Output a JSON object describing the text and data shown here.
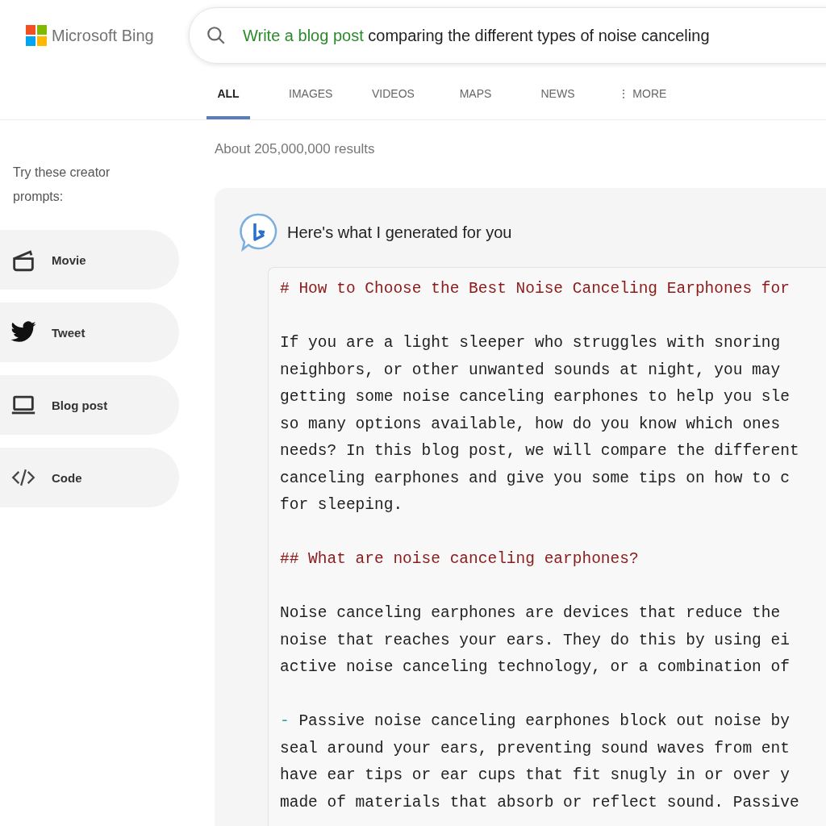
{
  "logo": {
    "text": "Microsoft Bing"
  },
  "search": {
    "highlight": "Write a blog post",
    "rest": "comparing the different types of noise canceling"
  },
  "tabs": [
    {
      "label": "ALL",
      "selected": true
    },
    {
      "label": "IMAGES",
      "selected": false
    },
    {
      "label": "VIDEOS",
      "selected": false
    },
    {
      "label": "MAPS",
      "selected": false
    },
    {
      "label": "NEWS",
      "selected": false
    },
    {
      "label": "⋮ MORE",
      "selected": false
    }
  ],
  "result_count": "About 205,000,000 results",
  "sidebar": {
    "heading": "Try these creator prompts:",
    "items": [
      {
        "kind": "movie",
        "label": "Movie"
      },
      {
        "kind": "tweet",
        "label": "Tweet"
      },
      {
        "kind": "blog",
        "label": "Blog post"
      },
      {
        "kind": "code",
        "label": "Code"
      }
    ]
  },
  "answer": {
    "title": "Here's what I generated for you",
    "lines": [
      {
        "kind": "heading",
        "text": "# How to Choose the Best Noise Canceling Earphones for"
      },
      {
        "kind": "blank"
      },
      {
        "kind": "text",
        "text": "If you are a light sleeper who struggles with snoring"
      },
      {
        "kind": "text",
        "text": "neighbors, or other unwanted sounds at night, you may"
      },
      {
        "kind": "text",
        "text": "getting some noise canceling earphones to help you sle"
      },
      {
        "kind": "text",
        "text": "so many options available, how do you know which ones"
      },
      {
        "kind": "text",
        "text": "needs? In this blog post, we will compare the different"
      },
      {
        "kind": "text",
        "text": "canceling earphones and give you some tips on how to c"
      },
      {
        "kind": "text",
        "text": "for sleeping."
      },
      {
        "kind": "blank"
      },
      {
        "kind": "heading",
        "text": "## What are noise canceling earphones?"
      },
      {
        "kind": "blank"
      },
      {
        "kind": "text",
        "text": "Noise canceling earphones are devices that reduce the"
      },
      {
        "kind": "text",
        "text": "noise that reaches your ears. They do this by using ei"
      },
      {
        "kind": "text",
        "text": "active noise canceling technology, or a combination of"
      },
      {
        "kind": "blank"
      },
      {
        "kind": "bullet",
        "marker": "-",
        "text": "Passive noise canceling earphones block out noise by"
      },
      {
        "kind": "text",
        "text": "seal around your ears, preventing sound waves from ent"
      },
      {
        "kind": "text",
        "text": "have ear tips or ear cups that fit snugly in or over y"
      },
      {
        "kind": "text",
        "text": "made of materials that absorb or reflect sound. Passive"
      }
    ]
  }
}
